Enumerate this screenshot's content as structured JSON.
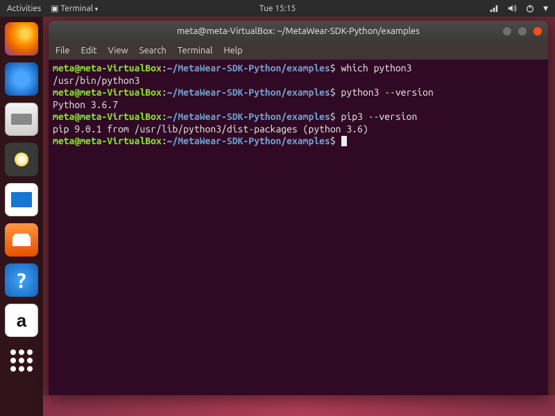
{
  "topbar": {
    "activities": "Activities",
    "app_menu": "Terminal",
    "clock": "Tue 15:15"
  },
  "launcher": {
    "items": [
      {
        "name": "firefox"
      },
      {
        "name": "thunderbird"
      },
      {
        "name": "files"
      },
      {
        "name": "rhythmbox"
      },
      {
        "name": "libreoffice-writer"
      },
      {
        "name": "ubuntu-software"
      },
      {
        "name": "help"
      },
      {
        "name": "amazon"
      },
      {
        "name": "show-applications"
      }
    ],
    "amazon_letter": "a",
    "help_char": "?"
  },
  "window": {
    "title": "meta@meta-VirtualBox: ~/MetaWear-SDK-Python/examples",
    "menu": [
      "File",
      "Edit",
      "View",
      "Search",
      "Terminal",
      "Help"
    ]
  },
  "prompt": {
    "user_host": "meta@meta-VirtualBox",
    "sep1": ":",
    "path": "~/MetaWear-SDK-Python/examples",
    "sigil": "$"
  },
  "terminal": {
    "lines": [
      {
        "cmd": "which python3"
      },
      {
        "out": "/usr/bin/python3"
      },
      {
        "cmd": "python3 --version"
      },
      {
        "out": "Python 3.6.7"
      },
      {
        "cmd": "pip3 --version"
      },
      {
        "out": "pip 9.0.1 from /usr/lib/python3/dist-packages (python 3.6)"
      },
      {
        "cmd": ""
      }
    ]
  }
}
